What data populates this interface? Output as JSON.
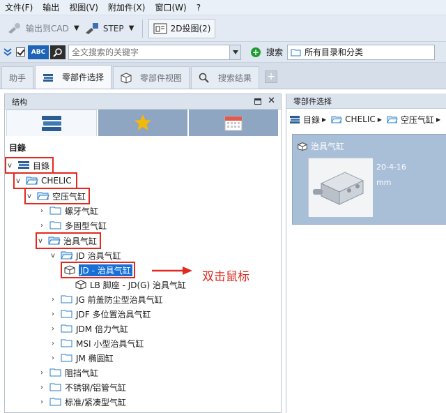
{
  "menubar": {
    "items": [
      "文件(F)",
      "输出",
      "视图(V)",
      "附加件(X)",
      "窗口(W)",
      "?"
    ]
  },
  "toolbar": {
    "export_cad": "输出到CAD",
    "step": "STEP",
    "view_2d": "2D投图(2)"
  },
  "search": {
    "abc_label": "ABC",
    "input_placeholder": "全文搜索的关键字",
    "search_label": "搜索",
    "scope_value": "所有目录和分类"
  },
  "tabs": [
    {
      "label": "助手"
    },
    {
      "label": "零部件选择"
    },
    {
      "label": "零部件视图"
    },
    {
      "label": "搜索结果"
    }
  ],
  "tabs_add": "+",
  "left_panel": {
    "title": "结构",
    "tree_title": "目錄",
    "nodes": [
      {
        "label": "目錄"
      },
      {
        "label": "CHELIC"
      },
      {
        "label": "空压气缸"
      },
      {
        "label": "螺牙气缸"
      },
      {
        "label": "多固型气缸"
      },
      {
        "label": "治具气缸"
      },
      {
        "label": "JD 治具气缸"
      },
      {
        "label": "JD - 治具气缸"
      },
      {
        "label": "LB 脚座 - JD(G) 治具气缸"
      },
      {
        "label": "JG 前盖防尘型治具气缸"
      },
      {
        "label": "JDF 多位置治具气缸"
      },
      {
        "label": "JDM 倍力气缸"
      },
      {
        "label": "MSI 小型治具气缸"
      },
      {
        "label": "JM 椭圆缸"
      },
      {
        "label": "阻挡气缸"
      },
      {
        "label": "不锈钢/铝管气缸"
      },
      {
        "label": "标准/紧凑型气缸"
      }
    ]
  },
  "annotation": {
    "text": "双击鼠标",
    "color": "#e02a20"
  },
  "right_panel": {
    "title": "零部件选择",
    "breadcrumbs": [
      "目錄",
      "CHELIC",
      "空压气缸"
    ],
    "card": {
      "title": "治具气缸",
      "date": "20-4-16",
      "unit": "mm"
    }
  },
  "colors": {
    "selection": "#1670d8",
    "highlight_box": "#e3291e",
    "card_bg": "#a9bfd8",
    "accent_blue": "#1e63b5"
  }
}
